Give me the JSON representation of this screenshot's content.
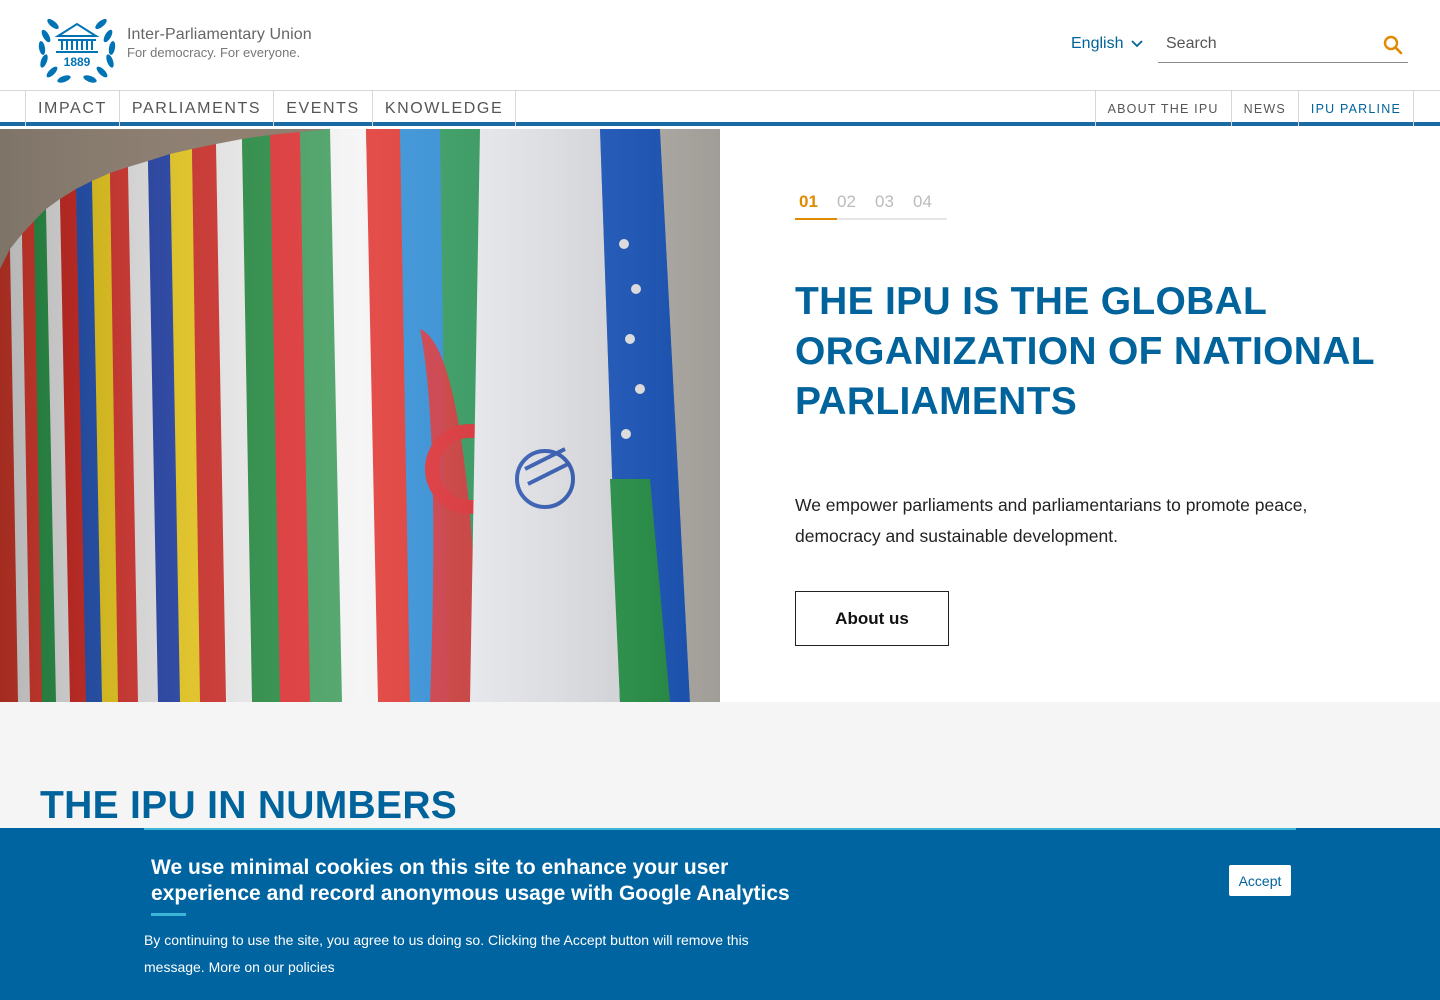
{
  "brand": {
    "name": "Inter-Parliamentary Union",
    "tagline": "For democracy. For everyone.",
    "logo_year": "1889",
    "primary_color": "#00639c",
    "accent_color": "#e08a00"
  },
  "header": {
    "language": "English",
    "search_placeholder": "Search"
  },
  "nav": {
    "main": [
      {
        "label": "IMPACT"
      },
      {
        "label": "PARLIAMENTS"
      },
      {
        "label": "EVENTS"
      },
      {
        "label": "KNOWLEDGE"
      }
    ],
    "secondary": [
      {
        "label": "ABOUT THE IPU"
      },
      {
        "label": "NEWS"
      },
      {
        "label": "IPU PARLINE"
      }
    ]
  },
  "hero": {
    "slides": [
      "01",
      "02",
      "03",
      "04"
    ],
    "active_slide": "01",
    "title": "THE IPU IS THE GLOBAL ORGANIZATION OF NATIONAL PARLIAMENTS",
    "text": "We empower parliaments and parliamentarians to promote peace, democracy and sustainable development.",
    "button": "About us"
  },
  "numbers": {
    "title": "THE IPU IN NUMBERS"
  },
  "cookie": {
    "title": "We use minimal cookies on this site to enhance your user experience and record anonymous usage with Google Analytics",
    "text": "By continuing to use the site, you agree to us doing so. Clicking the Accept button will remove this message. More on our policies",
    "accept": "Accept"
  }
}
